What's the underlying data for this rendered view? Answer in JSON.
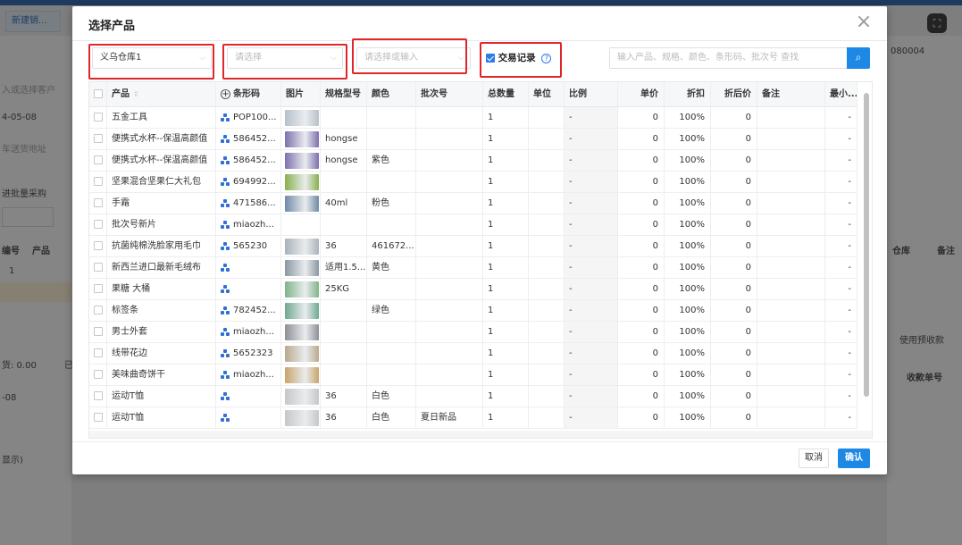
{
  "background": {
    "tab_label": "新建销...",
    "customer_placeholder": "入或选择客户",
    "date": "4-05-08",
    "address_placeholder": "车送货地址",
    "batch_label": "进批量采购",
    "order_no": "080004",
    "col_no": "编号",
    "col_product": "产品",
    "row_no": "1",
    "col_warehouse": "仓库",
    "col_remark": "备注",
    "amount": "货: 0.00",
    "amount_suffix": "已",
    "use_advance": "使用预收款",
    "receipt_no": "收款单号",
    "date2": "-08",
    "display_hint": "显示)"
  },
  "dialog": {
    "title": "选择产品",
    "warehouse_value": "义乌仓库1",
    "select_placeholder": "请选择",
    "batch_placeholder": "请选择或输入",
    "trade_record_label": "交易记录",
    "trade_record_checked": true,
    "search_placeholder": "输入产品、规格、颜色、条形码、批次号 查找",
    "cancel_label": "取消",
    "confirm_label": "确认"
  },
  "table": {
    "headers": {
      "product": "产品",
      "barcode": "条形码",
      "image": "图片",
      "spec": "规格型号",
      "color": "颜色",
      "batch": "批次号",
      "qty": "总数量",
      "unit": "单位",
      "ratio": "比例",
      "price": "单价",
      "discount": "折扣",
      "after_price": "折后价",
      "remark": "备注",
      "min": "最小..."
    },
    "rows": [
      {
        "product": "五金工具",
        "barcode": "POP100...",
        "spec": "",
        "color": "",
        "batch": "",
        "qty": "1",
        "ratio": "-",
        "price": "0",
        "discount": "100%",
        "after": "0",
        "min": "-",
        "thumb": "#b7c0c9"
      },
      {
        "product": "便携式水杯--保温高颜值",
        "barcode": "586452...",
        "spec": "hongse",
        "color": "",
        "batch": "",
        "qty": "1",
        "ratio": "-",
        "price": "0",
        "discount": "100%",
        "after": "0",
        "min": "-",
        "thumb": "#7d6fae"
      },
      {
        "product": "便携式水杯--保温高颜值",
        "barcode": "586452...",
        "spec": "hongse",
        "color": "紫色",
        "batch": "",
        "qty": "1",
        "ratio": "-",
        "price": "0",
        "discount": "100%",
        "after": "0",
        "min": "-",
        "thumb": "#7d6fae"
      },
      {
        "product": "坚果混合坚果仁大礼包",
        "barcode": "694992...",
        "spec": "",
        "color": "",
        "batch": "",
        "qty": "1",
        "ratio": "-",
        "price": "0",
        "discount": "100%",
        "after": "0",
        "min": "-",
        "thumb": "#88b04b"
      },
      {
        "product": "手霜",
        "barcode": "471586...",
        "spec": "40ml",
        "color": "粉色",
        "batch": "",
        "qty": "1",
        "ratio": "-",
        "price": "0",
        "discount": "100%",
        "after": "0",
        "min": "-",
        "thumb": "#6f8aa6"
      },
      {
        "product": "批次号新片",
        "barcode": "miaozh...",
        "spec": "",
        "color": "",
        "batch": "",
        "qty": "1",
        "ratio": "-",
        "price": "0",
        "discount": "100%",
        "after": "0",
        "min": "-",
        "thumb": ""
      },
      {
        "product": "抗菌纯棉洗脸家用毛巾",
        "barcode": "565230",
        "spec": "36",
        "color": "461672...",
        "batch": "",
        "qty": "1",
        "ratio": "-",
        "price": "0",
        "discount": "100%",
        "after": "0",
        "min": "-",
        "thumb": "#a9b3bb"
      },
      {
        "product": "新西兰进口最新毛绒布",
        "barcode": "",
        "spec": "适用1.5...",
        "color": "黄色",
        "batch": "",
        "qty": "1",
        "ratio": "-",
        "price": "0",
        "discount": "100%",
        "after": "0",
        "min": "-",
        "thumb": "#8a97a3"
      },
      {
        "product": "果糖 大桶",
        "barcode": "",
        "spec": "25KG",
        "color": "",
        "batch": "",
        "qty": "1",
        "ratio": "-",
        "price": "0",
        "discount": "100%",
        "after": "0",
        "min": "-",
        "thumb": "#7fb38a"
      },
      {
        "product": "标签条",
        "barcode": "782452...",
        "spec": "",
        "color": "绿色",
        "batch": "",
        "qty": "1",
        "ratio": "-",
        "price": "0",
        "discount": "100%",
        "after": "0",
        "min": "-",
        "thumb": "#6fa88f"
      },
      {
        "product": "男士外套",
        "barcode": "miaozh...",
        "spec": "",
        "color": "",
        "batch": "",
        "qty": "1",
        "ratio": "-",
        "price": "0",
        "discount": "100%",
        "after": "0",
        "min": "-",
        "thumb": "#8d8f94"
      },
      {
        "product": "线带花边",
        "barcode": "5652323",
        "spec": "",
        "color": "",
        "batch": "",
        "qty": "1",
        "ratio": "-",
        "price": "0",
        "discount": "100%",
        "after": "0",
        "min": "-",
        "thumb": "#b9a98c"
      },
      {
        "product": "美味曲奇饼干",
        "barcode": "miaozh...",
        "spec": "",
        "color": "",
        "batch": "",
        "qty": "1",
        "ratio": "-",
        "price": "0",
        "discount": "100%",
        "after": "0",
        "min": "-",
        "thumb": "#c9a46a"
      },
      {
        "product": "运动T恤",
        "barcode": "",
        "spec": "36",
        "color": "白色",
        "batch": "",
        "qty": "1",
        "ratio": "-",
        "price": "0",
        "discount": "100%",
        "after": "0",
        "min": "-",
        "thumb": "#c7c7c7"
      },
      {
        "product": "运动T恤",
        "barcode": "",
        "spec": "36",
        "color": "白色",
        "batch": "夏日新品",
        "qty": "1",
        "ratio": "-",
        "price": "0",
        "discount": "100%",
        "after": "0",
        "min": "-",
        "thumb": "#c7c7c7"
      }
    ]
  },
  "colors": {
    "accent": "#1e88e5",
    "highlight_box": "#e0262b"
  }
}
